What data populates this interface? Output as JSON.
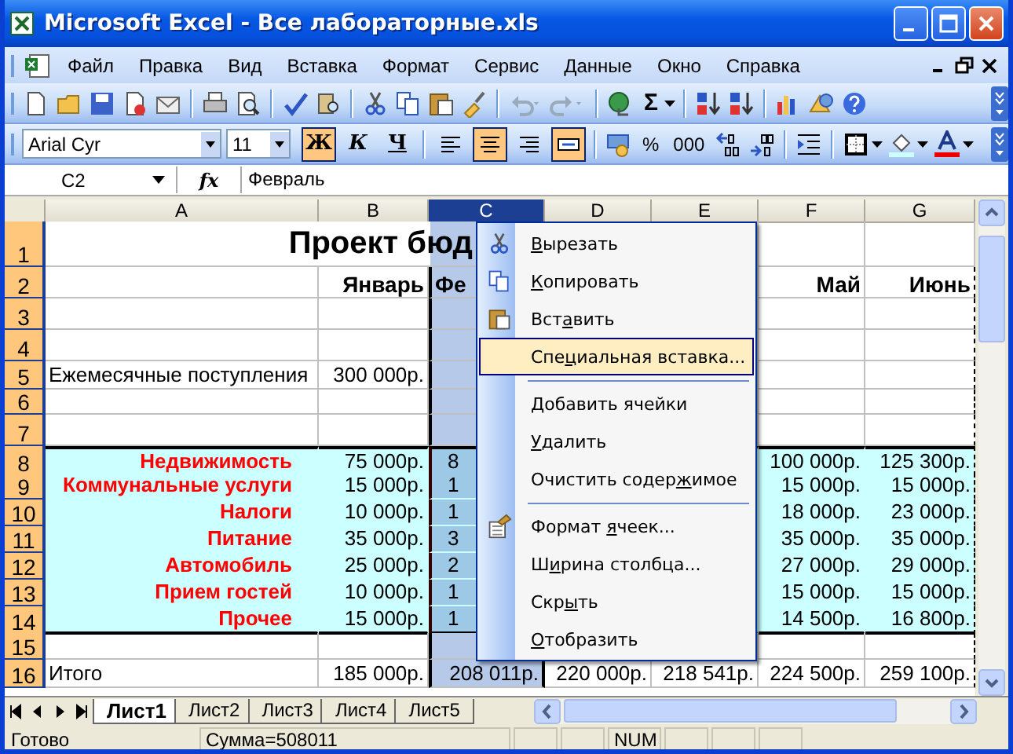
{
  "window": {
    "title": "Microsoft Excel - Все лабораторные.xls"
  },
  "menu": [
    "Файл",
    "Правка",
    "Вид",
    "Вставка",
    "Формат",
    "Сервис",
    "Данные",
    "Окно",
    "Справка"
  ],
  "standard_toolbar": {
    "sum": "Σ"
  },
  "format_toolbar": {
    "font": "Arial Cyr",
    "size": "11",
    "buttons": [
      {
        "label": "Ж",
        "kind": "bold",
        "pressed": true
      },
      {
        "label": "К",
        "kind": "italic",
        "pressed": false
      },
      {
        "label": "Ч",
        "kind": "underline",
        "pressed": false
      }
    ],
    "align": [
      {
        "kind": "left",
        "pressed": false
      },
      {
        "kind": "center",
        "pressed": true
      },
      {
        "kind": "right",
        "pressed": false
      },
      {
        "kind": "merge",
        "pressed": true
      }
    ],
    "percent": "%",
    "thousands": "000"
  },
  "formula_bar": {
    "cell": "C2",
    "fx": "fx",
    "value": "Февраль"
  },
  "columns": [
    {
      "label": "A",
      "selected": false
    },
    {
      "label": "B",
      "selected": false
    },
    {
      "label": "C",
      "selected": true
    },
    {
      "label": "D",
      "selected": false
    },
    {
      "label": "E",
      "selected": false
    },
    {
      "label": "F",
      "selected": false
    },
    {
      "label": "G",
      "selected": false
    }
  ],
  "rows": [
    {
      "number": "1",
      "kind": "title",
      "a": "Проект бюд"
    },
    {
      "number": "2",
      "kind": "header",
      "b": "Январь",
      "c": {
        "text": "Фе",
        "clipped": true
      },
      "f": "Май",
      "g": "Июнь"
    },
    {
      "number": "3",
      "kind": "plain"
    },
    {
      "number": "4",
      "kind": "plain"
    },
    {
      "number": "5",
      "kind": "plain",
      "a": "Ежемесячные поступления",
      "b": "300 000р."
    },
    {
      "number": "6",
      "kind": "plain"
    },
    {
      "number": "7",
      "kind": "plain"
    },
    {
      "number": "8",
      "kind": "category",
      "a": "Недвижимость",
      "b": "75 000р.",
      "c": {
        "text": "8",
        "clipped": true
      },
      "f": "100 000р.",
      "g": "125 300р."
    },
    {
      "number": "9",
      "kind": "category",
      "a": "Коммунальные услуги",
      "b": "15 000р.",
      "c": {
        "text": "1",
        "clipped": true
      },
      "f": "15 000р.",
      "g": "15 000р."
    },
    {
      "number": "10",
      "kind": "category",
      "a": "Налоги",
      "b": "10 000р.",
      "c": {
        "text": "1",
        "clipped": true
      },
      "f": "18 000р.",
      "g": "23 000р."
    },
    {
      "number": "11",
      "kind": "category",
      "a": "Питание",
      "b": "35 000р.",
      "c": {
        "text": "3",
        "clipped": true
      },
      "f": "35 000р.",
      "g": "35 000р."
    },
    {
      "number": "12",
      "kind": "category",
      "a": "Автомобиль",
      "b": "25 000р.",
      "c": {
        "text": "2",
        "clipped": true
      },
      "f": "27 000р.",
      "g": "29 000р."
    },
    {
      "number": "13",
      "kind": "category",
      "a": "Прием гостей",
      "b": "10 000р.",
      "c": {
        "text": "1",
        "clipped": true
      },
      "f": "15 000р.",
      "g": "15 000р."
    },
    {
      "number": "14",
      "kind": "category",
      "a": "Прочее",
      "b": "15 000р.",
      "c": {
        "text": "1",
        "clipped": true
      },
      "f": "14 500р.",
      "g": "16 800р."
    },
    {
      "number": "15",
      "kind": "plain"
    },
    {
      "number": "16",
      "kind": "plain",
      "a": "Итого",
      "b": "185 000р.",
      "c": "208 011р.",
      "d": "220 000р.",
      "e": "218 541р.",
      "f": "224 500р.",
      "g": "259 100р."
    }
  ],
  "context_menu": [
    {
      "kind": "cut",
      "key": "В",
      "post": "ырезать",
      "selected": false,
      "separator_before": false
    },
    {
      "kind": "copy",
      "key": "К",
      "post": "опировать",
      "selected": false,
      "separator_before": false
    },
    {
      "kind": "paste",
      "pre": "Вст",
      "key": "а",
      "post": "вить",
      "selected": false,
      "separator_before": false
    },
    {
      "kind": "plain",
      "pre": "Спе",
      "key": "ц",
      "post": "иальная вставка...",
      "selected": true,
      "separator_before": false
    },
    {
      "kind": "plain",
      "key": "Д",
      "post": "обавить ячейки",
      "selected": false,
      "separator_before": true
    },
    {
      "kind": "plain",
      "key": "У",
      "post": "далить",
      "selected": false,
      "separator_before": false
    },
    {
      "kind": "plain",
      "pre": "Очистить содер",
      "key": "ж",
      "post": "имое",
      "selected": false,
      "separator_before": false
    },
    {
      "kind": "format",
      "pre": "Формат ",
      "key": "я",
      "post": "чеек...",
      "selected": false,
      "separator_before": true
    },
    {
      "kind": "plain",
      "pre": "Ш",
      "key": "и",
      "post": "рина столбца...",
      "selected": false,
      "separator_before": false
    },
    {
      "kind": "plain",
      "pre": "Скр",
      "key": "ы",
      "post": "ть",
      "selected": false,
      "separator_before": false
    },
    {
      "kind": "plain",
      "key": "О",
      "post": "тобразить",
      "selected": false,
      "separator_before": false
    }
  ],
  "sheet_tabs": [
    {
      "label": "Лист1",
      "selected": true
    },
    {
      "label": "Лист2",
      "selected": false
    },
    {
      "label": "Лист3",
      "selected": false
    },
    {
      "label": "Лист4",
      "selected": false
    },
    {
      "label": "Лист5",
      "selected": false
    }
  ],
  "status_bar": {
    "state": "Готово",
    "sum": "Сумма=508011",
    "num": "NUM"
  }
}
